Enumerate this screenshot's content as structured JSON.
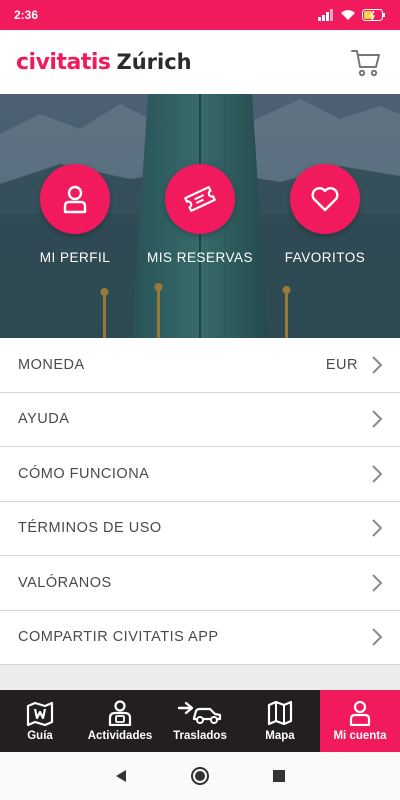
{
  "status_bar": {
    "time": "2:36"
  },
  "header": {
    "brand": "civitatis",
    "city": "Zúrich"
  },
  "hero": {
    "actions": [
      {
        "label": "MI PERFIL",
        "icon": "person-icon"
      },
      {
        "label": "MIS RESERVAS",
        "icon": "ticket-icon"
      },
      {
        "label": "FAVORITOS",
        "icon": "heart-icon"
      }
    ]
  },
  "menu": {
    "items": [
      {
        "label": "MONEDA",
        "value": "EUR"
      },
      {
        "label": "AYUDA"
      },
      {
        "label": "CÓMO FUNCIONA"
      },
      {
        "label": "TÉRMINOS DE USO"
      },
      {
        "label": "VALÓRANOS"
      },
      {
        "label": "COMPARTIR CIVITATIS APP"
      }
    ]
  },
  "bottom_nav": {
    "items": [
      {
        "label": "Guía",
        "icon": "map-pin-icon"
      },
      {
        "label": "Actividades",
        "icon": "guide-icon"
      },
      {
        "label": "Traslados",
        "icon": "car-icon"
      },
      {
        "label": "Mapa",
        "icon": "map-icon"
      },
      {
        "label": "Mi cuenta",
        "icon": "person-icon",
        "active": true
      }
    ]
  },
  "colors": {
    "accent": "#f01a5d",
    "nav_bg": "#231f20",
    "text": "#4a4a4a"
  }
}
